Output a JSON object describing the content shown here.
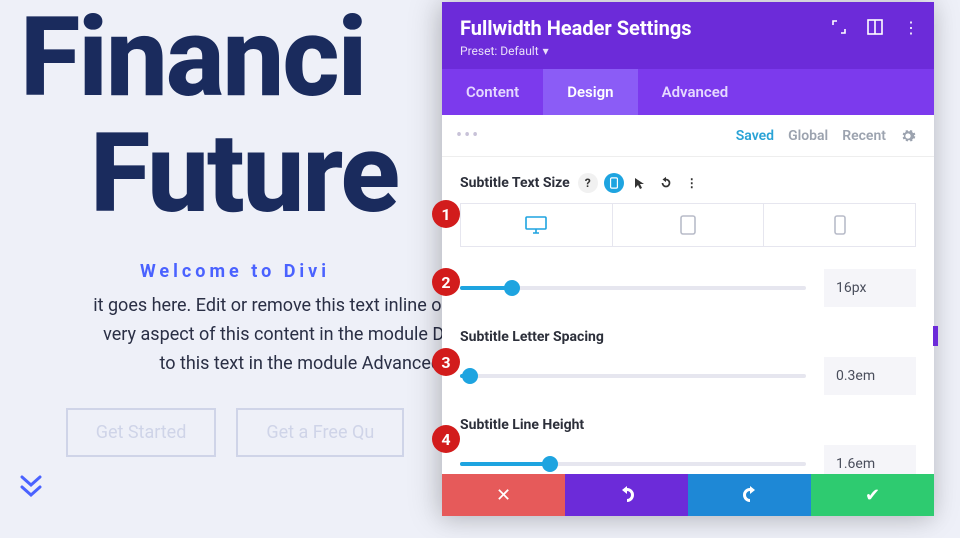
{
  "hero": {
    "title_line1": "Financi",
    "title_line2": "Future",
    "subtitle": "Welcome to Divi",
    "body_line1": "it goes here. Edit or remove this text inline or in the modu",
    "body_line2": "very aspect of this content in the module Design settin",
    "body_line3": "to this text in the module Advanced setti",
    "button1": "Get Started",
    "button2": "Get a Free Qu"
  },
  "panel": {
    "title": "Fullwidth Header Settings",
    "preset_label": "Preset: Default",
    "tabs": {
      "content": "Content",
      "design": "Design",
      "advanced": "Advanced"
    },
    "filters": {
      "saved": "Saved",
      "global": "Global",
      "recent": "Recent"
    },
    "sections": {
      "subtitle_text_size": {
        "label": "Subtitle Text Size",
        "value": "16px",
        "slider_pct": 15
      },
      "subtitle_letter_spacing": {
        "label": "Subtitle Letter Spacing",
        "value": "0.3em",
        "slider_pct": 3
      },
      "subtitle_line_height": {
        "label": "Subtitle Line Height",
        "value": "1.6em",
        "slider_pct": 26
      }
    }
  },
  "callouts": [
    "1",
    "2",
    "3",
    "4"
  ]
}
